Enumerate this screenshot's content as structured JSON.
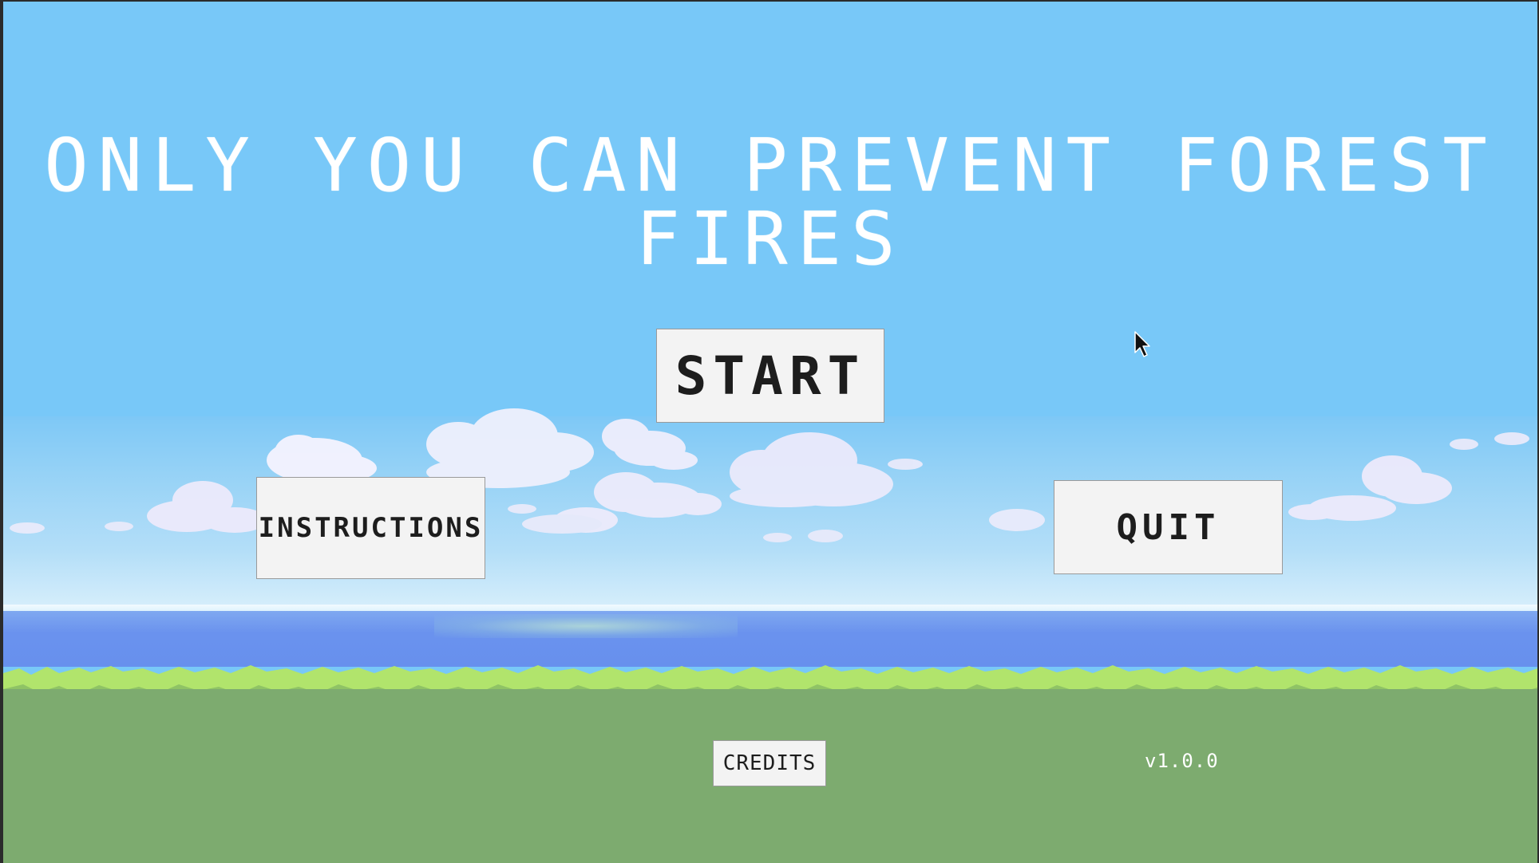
{
  "game": {
    "title": "ONLY YOU CAN PREVENT FOREST FIRES",
    "version": "v1.0.0"
  },
  "menu": {
    "start_label": "START",
    "instructions_label": "INSTRUCTIONS",
    "quit_label": "QUIT",
    "credits_label": "CREDITS"
  },
  "icons": {
    "cursor": "mouse-pointer-icon"
  },
  "colors": {
    "sky": "#78c8f8",
    "sea": "#6790ed",
    "grass_light": "#b1e46c",
    "ground": "#7dab6f",
    "button_bg": "#f3f3f3",
    "button_text": "#1d1d1d",
    "title_text": "#ffffff"
  }
}
